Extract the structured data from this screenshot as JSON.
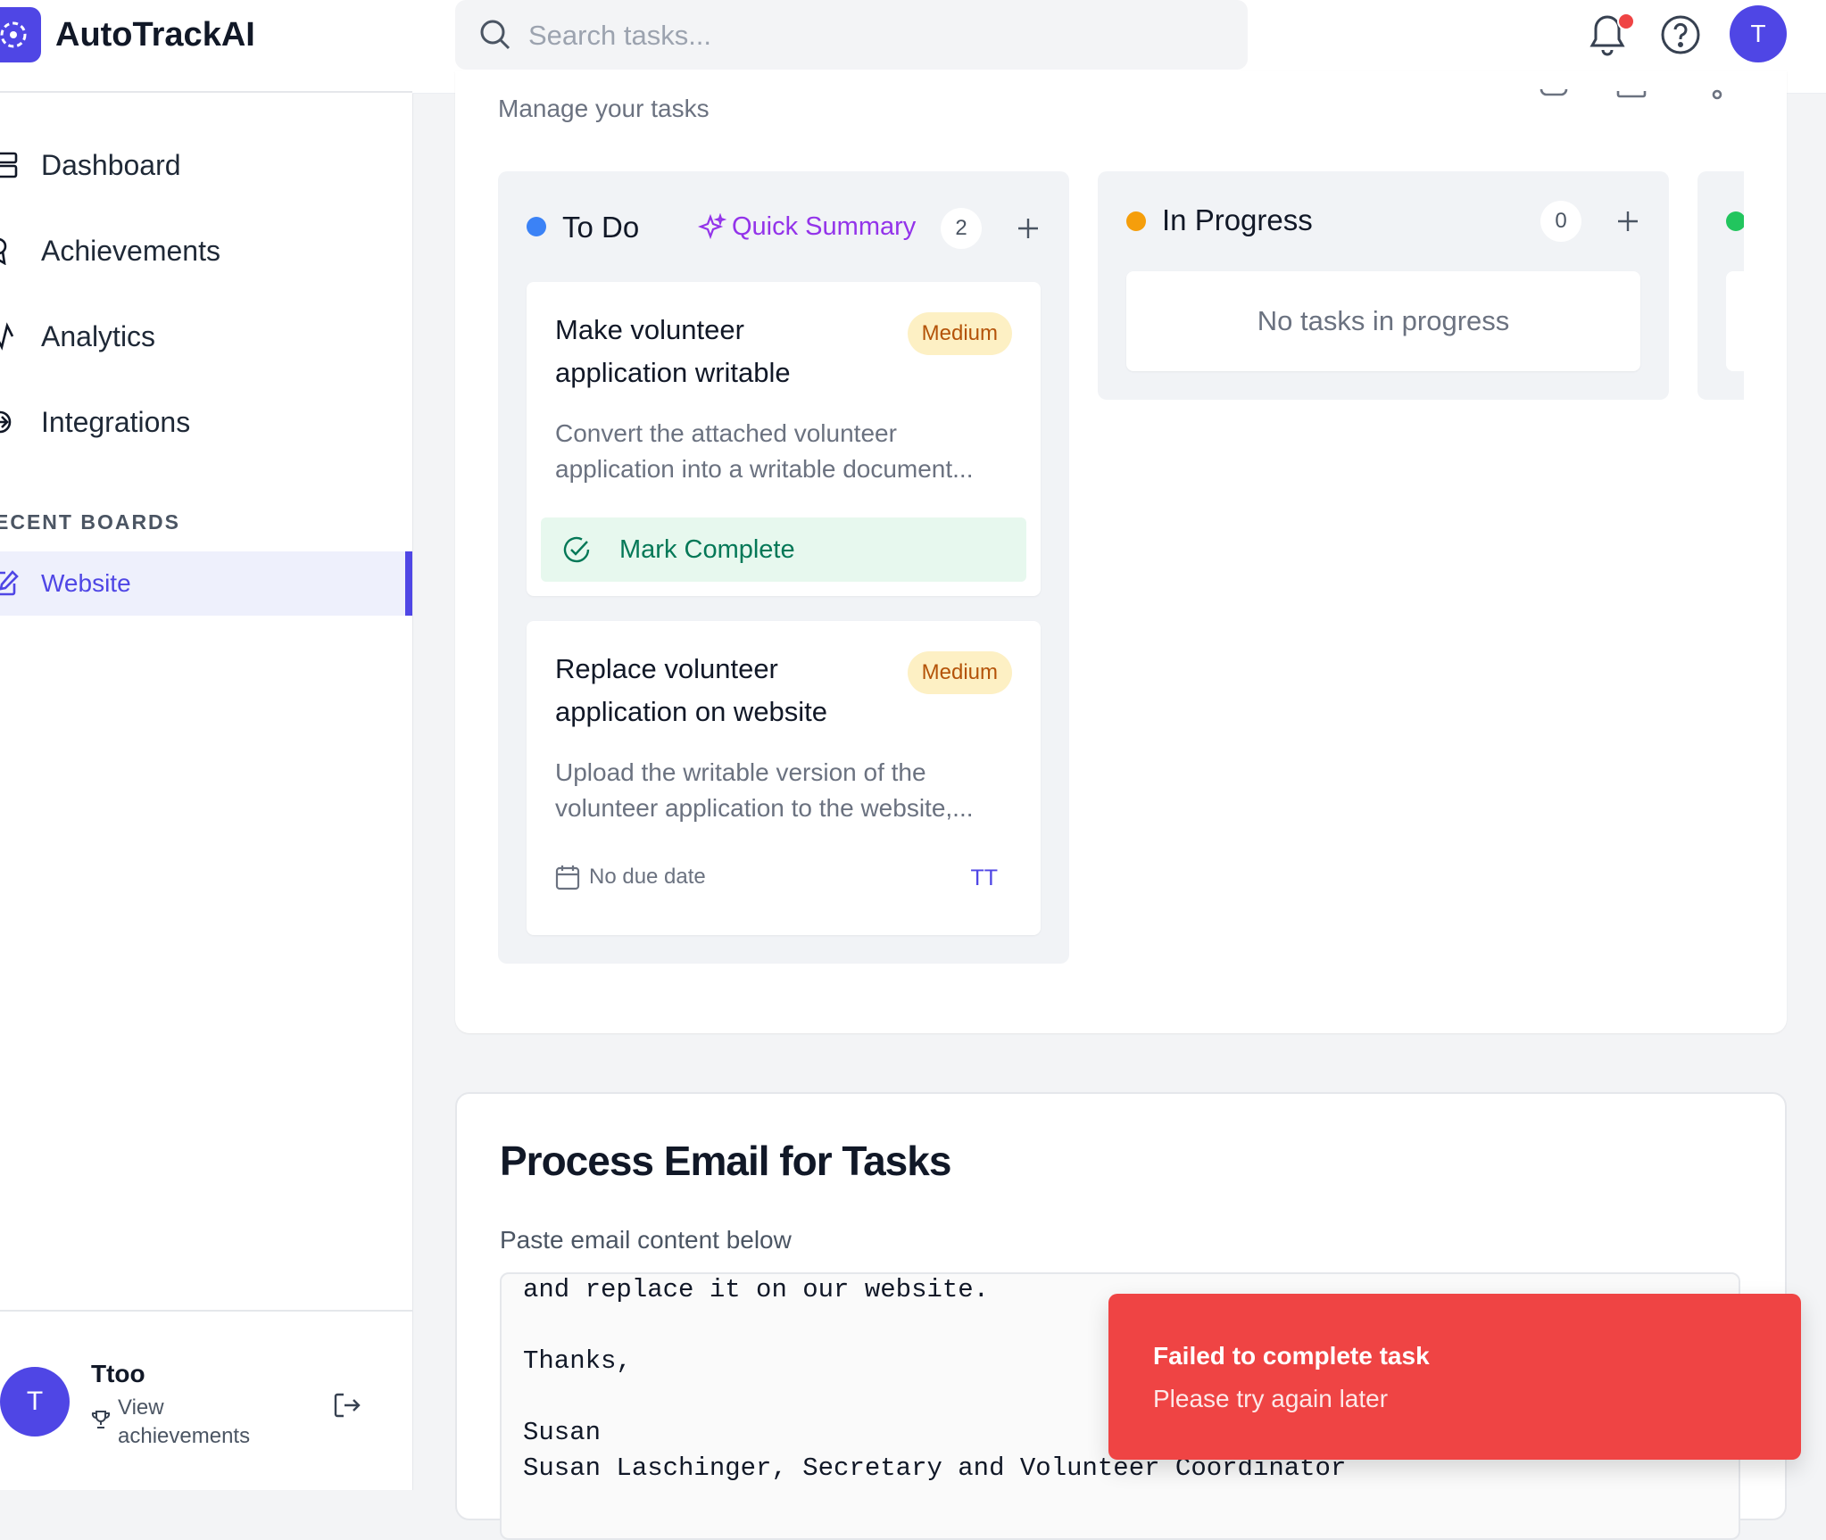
{
  "app": {
    "name": "AutoTrackAI"
  },
  "sidebar": {
    "nav": [
      {
        "label": "Dashboard",
        "icon": "dashboard-icon"
      },
      {
        "label": "Achievements",
        "icon": "award-icon"
      },
      {
        "label": "Analytics",
        "icon": "activity-icon"
      },
      {
        "label": "Integrations",
        "icon": "plug-icon"
      }
    ],
    "section_label": "ECENT BOARDS",
    "boards": [
      {
        "label": "Website",
        "icon": "edit-icon",
        "active": true
      }
    ],
    "user": {
      "initial": "T",
      "name": "Ttoo",
      "sub_label": "View achievements"
    }
  },
  "topbar": {
    "search_placeholder": "Search tasks...",
    "avatar_initial": "T",
    "has_notification": true
  },
  "board": {
    "subtitle": "Manage your tasks",
    "columns": [
      {
        "title": "To Do",
        "color": "#3b82f6",
        "quick_summary": "Quick Summary",
        "count": "2",
        "tasks": [
          {
            "title": "Make volunteer application writable",
            "priority": "Medium",
            "description": "Convert the attached volunteer application into a writable document...",
            "action": "Mark Complete"
          },
          {
            "title": "Replace volunteer application on website",
            "priority": "Medium",
            "description": "Upload the writable version of the volunteer application to the website,...",
            "due": "No due date",
            "assignee": "TT"
          }
        ]
      },
      {
        "title": "In Progress",
        "color": "#f59e0b",
        "count": "0",
        "empty_text": "No tasks in progress"
      },
      {
        "color": "#22c55e"
      }
    ]
  },
  "email": {
    "title": "Process Email for Tasks",
    "label": "Paste email content below",
    "lines": [
      "and replace it on our website.",
      "",
      "Thanks,",
      "",
      "Susan",
      "Susan Laschinger, Secretary and Volunteer Coordinator"
    ]
  },
  "toast": {
    "title": "Failed to complete task",
    "message": "Please try again later",
    "color": "#ef4444"
  }
}
